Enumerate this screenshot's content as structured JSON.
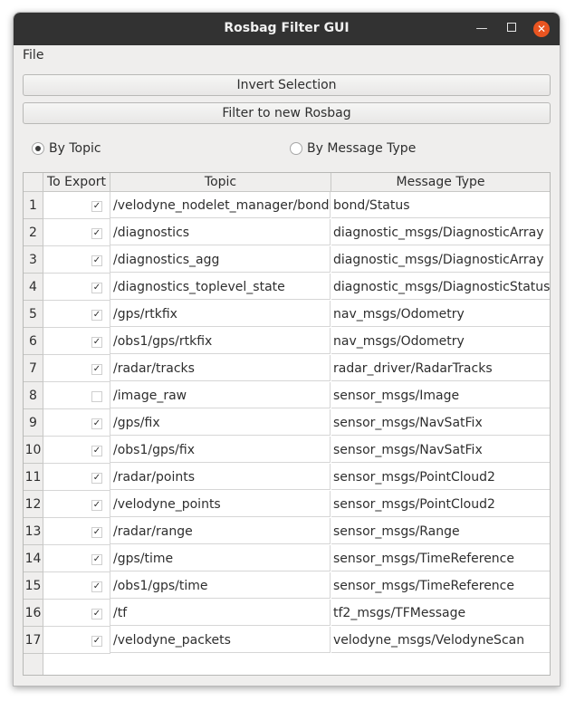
{
  "window": {
    "title": "Rosbag Filter GUI"
  },
  "menubar": {
    "file": "File"
  },
  "buttons": {
    "invert": "Invert Selection",
    "filter": "Filter to new Rosbag"
  },
  "radios": [
    {
      "label": "By Topic",
      "selected": true
    },
    {
      "label": "By Message Type",
      "selected": false
    }
  ],
  "table": {
    "headers": [
      "To Export",
      "Topic",
      "Message Type"
    ],
    "rows": [
      {
        "num": "1",
        "checked": true,
        "topic": "/velodyne_nodelet_manager/bond",
        "type": "bond/Status"
      },
      {
        "num": "2",
        "checked": true,
        "topic": "/diagnostics",
        "type": "diagnostic_msgs/DiagnosticArray"
      },
      {
        "num": "3",
        "checked": true,
        "topic": "/diagnostics_agg",
        "type": "diagnostic_msgs/DiagnosticArray"
      },
      {
        "num": "4",
        "checked": true,
        "topic": "/diagnostics_toplevel_state",
        "type": "diagnostic_msgs/DiagnosticStatus"
      },
      {
        "num": "5",
        "checked": true,
        "topic": "/gps/rtkfix",
        "type": "nav_msgs/Odometry"
      },
      {
        "num": "6",
        "checked": true,
        "topic": "/obs1/gps/rtkfix",
        "type": "nav_msgs/Odometry"
      },
      {
        "num": "7",
        "checked": true,
        "topic": "/radar/tracks",
        "type": "radar_driver/RadarTracks"
      },
      {
        "num": "8",
        "checked": false,
        "topic": "/image_raw",
        "type": "sensor_msgs/Image"
      },
      {
        "num": "9",
        "checked": true,
        "topic": "/gps/fix",
        "type": "sensor_msgs/NavSatFix"
      },
      {
        "num": "10",
        "checked": true,
        "topic": "/obs1/gps/fix",
        "type": "sensor_msgs/NavSatFix"
      },
      {
        "num": "11",
        "checked": true,
        "topic": "/radar/points",
        "type": "sensor_msgs/PointCloud2"
      },
      {
        "num": "12",
        "checked": true,
        "topic": "/velodyne_points",
        "type": "sensor_msgs/PointCloud2"
      },
      {
        "num": "13",
        "checked": true,
        "topic": "/radar/range",
        "type": "sensor_msgs/Range"
      },
      {
        "num": "14",
        "checked": true,
        "topic": "/gps/time",
        "type": "sensor_msgs/TimeReference"
      },
      {
        "num": "15",
        "checked": true,
        "topic": "/obs1/gps/time",
        "type": "sensor_msgs/TimeReference"
      },
      {
        "num": "16",
        "checked": true,
        "topic": "/tf",
        "type": "tf2_msgs/TFMessage"
      },
      {
        "num": "17",
        "checked": true,
        "topic": "/velodyne_packets",
        "type": "velodyne_msgs/VelodyneScan"
      }
    ]
  },
  "icons": {
    "minimize": "minimize-icon",
    "maximize": "maximize-icon",
    "close": "close-icon",
    "check": "checkmark-icon"
  },
  "colors": {
    "titlebar": "#323232",
    "close_button": "#e95420",
    "window_bg": "#efeeed"
  }
}
